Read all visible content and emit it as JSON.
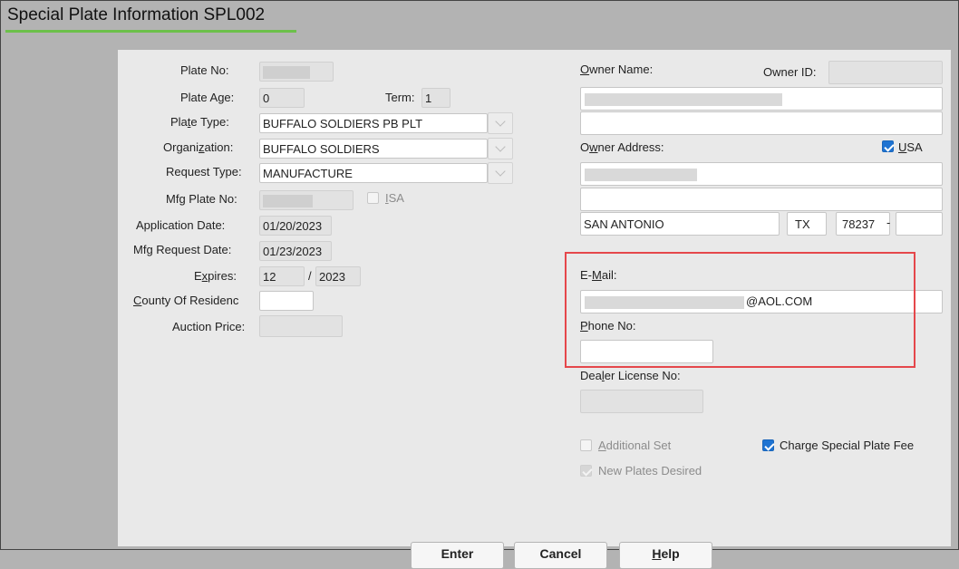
{
  "window": {
    "title": "Special Plate Information SPL002"
  },
  "left": {
    "plate_no_label": "Plate No:",
    "plate_no_value": "",
    "plate_age_label": "Plate Age:",
    "plate_age_value": "0",
    "term_label": "Term:",
    "term_value": "1",
    "plate_type_label": "Plate Type:",
    "plate_type_value": "BUFFALO SOLDIERS PB PLT",
    "organization_label": "Organization:",
    "organization_value": "BUFFALO SOLDIERS",
    "request_type_label": "Request Type:",
    "request_type_value": "MANUFACTURE",
    "mfg_plate_no_label": "Mfg Plate No:",
    "isa_label": "ISA",
    "application_date_label": "Application Date:",
    "application_date_value": "01/20/2023",
    "mfg_request_date_label": "Mfg Request Date:",
    "mfg_request_date_value": "01/23/2023",
    "expires_label": "Expires:",
    "expires_month": "12",
    "expires_sep": "/",
    "expires_year": "2023",
    "county_label": "County Of Residenc",
    "auction_price_label": "Auction Price:"
  },
  "right": {
    "owner_name_label": "Owner Name:",
    "owner_id_label": "Owner ID:",
    "owner_address_label": "Owner Address:",
    "usa_label": "USA",
    "city_value": "SAN ANTONIO",
    "state_value": "TX",
    "zip_value": "78237",
    "zip_sep": "-",
    "email_label": "E-Mail:",
    "email_domain": "@AOL.COM",
    "phone_label": "Phone No:",
    "dealer_license_label": "Dealer License No:",
    "additional_set_label": "Additional Set",
    "new_plates_label": "New Plates Desired",
    "charge_fee_label": "Charge Special Plate Fee"
  },
  "buttons": {
    "enter": "Enter",
    "cancel": "Cancel",
    "help": "Help"
  },
  "colors": {
    "highlight": "#e5474b",
    "checkbox": "#1e73d2",
    "title_underline": "#6cc04a"
  }
}
